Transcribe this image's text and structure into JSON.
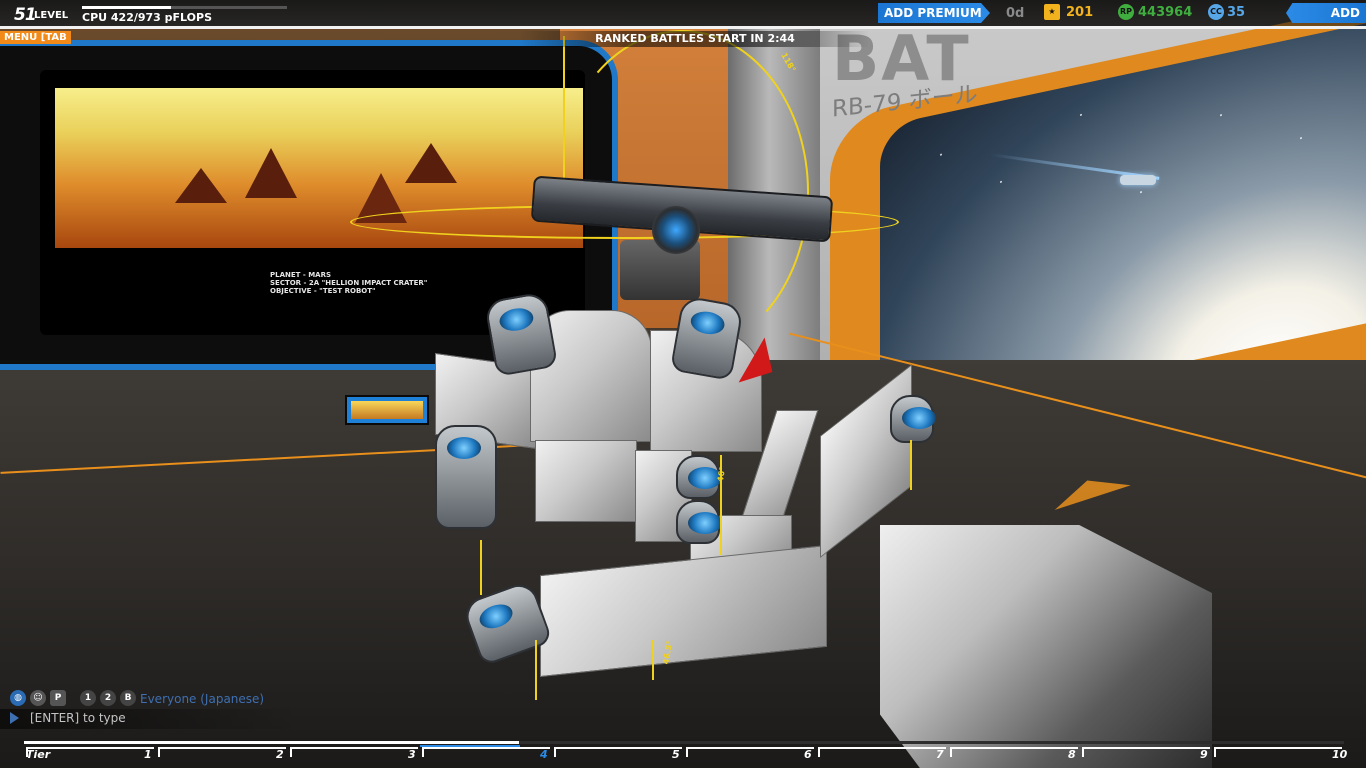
{
  "hud": {
    "level": "51",
    "level_label": "LEVEL",
    "cpu_text": "CPU 422/973 pFLOPS",
    "cpu_used": 422,
    "cpu_max": 973,
    "add_premium_label": "ADD PREMIUM",
    "premium_days": "0d",
    "stars": "201",
    "robits": "443964",
    "cosmetic_credits": "35",
    "add_funds_label": "ADD FUNDS",
    "menu_tab": "MENU [TAB",
    "ranked_banner": "RANKED BATTLES START IN 2:44",
    "icons": {
      "star": "star-icon",
      "rp": "rp-coin-icon",
      "cc": "cc-coin-icon"
    },
    "star_icon_glyph": "★",
    "rp_icon_glyph": "RP",
    "cc_icon_glyph": "CC",
    "colors": {
      "premium_blue": "#2b8be6",
      "menu_orange": "#f28a1a",
      "stars": "#f2b21d",
      "robits": "#3fae3f",
      "cc": "#56a6e8"
    }
  },
  "scene": {
    "wall_sign": "BAT",
    "wall_sub_label": "RB-79 ボール",
    "mission_lines": [
      "PLANET - MARS",
      "SECTOR - 2A \"HELLION IMPACT CRATER\"",
      "OBJECTIVE - \"TEST ROBOT\""
    ],
    "angle_tag": "118°",
    "thruster_tag_1": "46.5°",
    "thruster_tag_2": "46°"
  },
  "chat": {
    "icons": [
      "globe-icon",
      "accessibility-icon",
      "P",
      "1",
      "2",
      "B"
    ],
    "channel": "Everyone (Japanese)",
    "hint": "[ENTER] to type"
  },
  "tier_bar": {
    "label": "Tier",
    "tiers": [
      "1",
      "2",
      "3",
      "4",
      "5",
      "6",
      "7",
      "8",
      "9",
      "10"
    ],
    "current_tier": "4",
    "progress_fraction": 0.375
  }
}
